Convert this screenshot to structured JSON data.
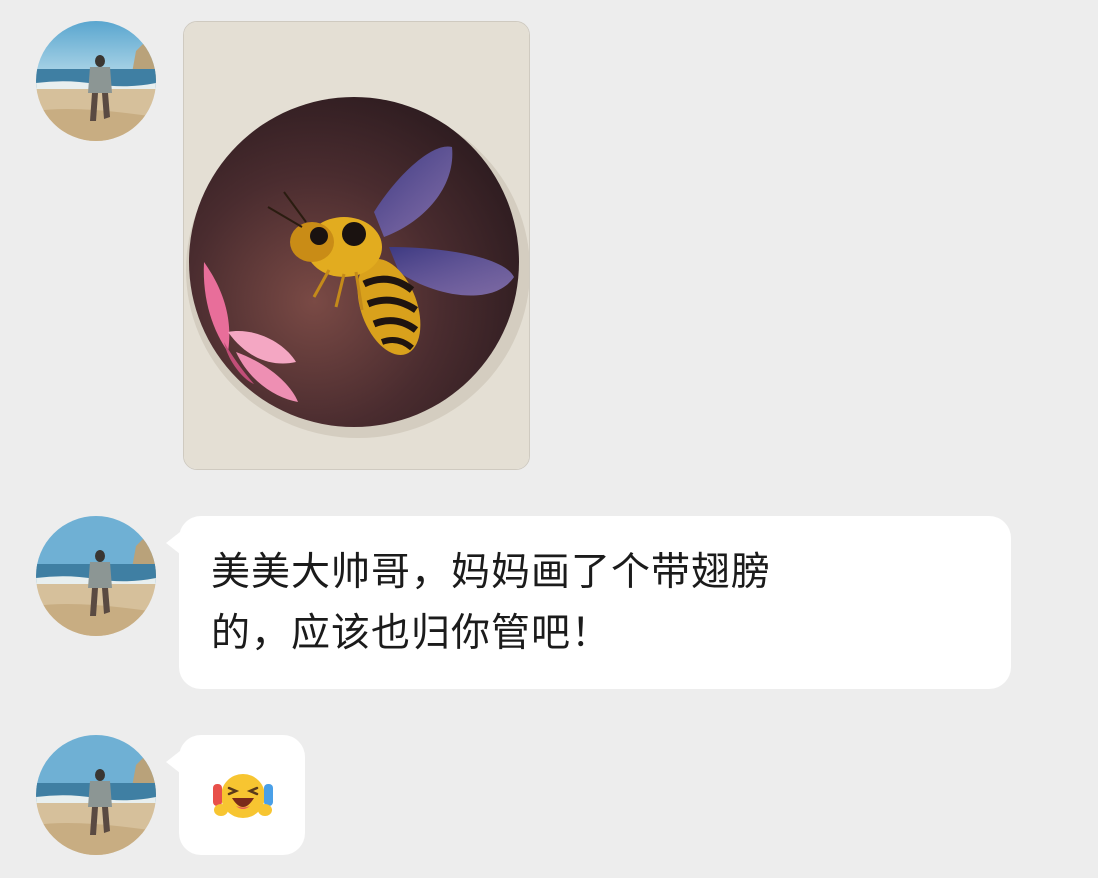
{
  "messages": [
    {
      "type": "image",
      "image_description_icon": "painted-stone-bee-image"
    },
    {
      "type": "text",
      "text": "美美大帅哥，妈妈画了个带翅膀\n的，应该也归你管吧！"
    },
    {
      "type": "sticker",
      "icon": "laughing-cheering-emoji-icon"
    }
  ],
  "colors": {
    "background": "#ededed",
    "bubble": "#ffffff",
    "text": "#1b1b1b"
  }
}
